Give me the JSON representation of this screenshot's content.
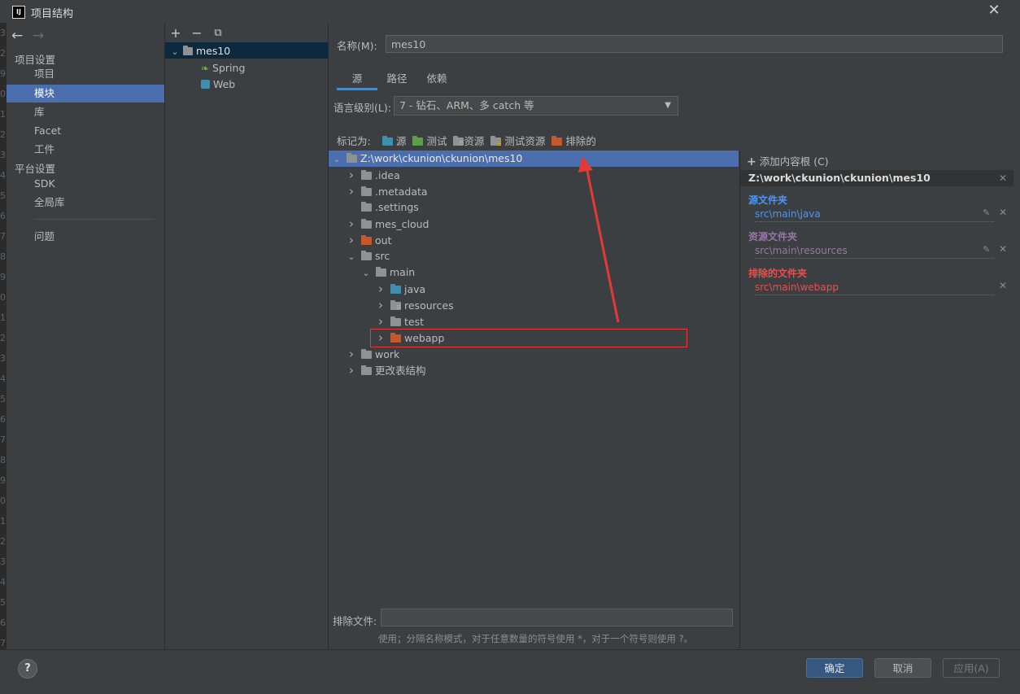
{
  "window": {
    "title": "项目结构",
    "logo": "IJ"
  },
  "gutter": {
    "numbers": [
      "3",
      "2",
      "9",
      "0",
      "1",
      "2",
      "3",
      "4",
      "5",
      "6",
      "7",
      "8",
      "9",
      "0",
      "1",
      "2",
      "3",
      "4",
      "5",
      "6",
      "7",
      "8",
      "9",
      "0",
      "1",
      "2",
      "3",
      "4",
      "5",
      "6",
      "7",
      "8",
      "9"
    ]
  },
  "sidebar": {
    "section1": "项目设置",
    "items1": [
      "项目",
      "模块",
      "库",
      "Facet",
      "工件"
    ],
    "selected": "模块",
    "section2": "平台设置",
    "items2": [
      "SDK",
      "全局库"
    ],
    "problems": "问题"
  },
  "modules": {
    "toolbar": {
      "add": "+",
      "remove": "−",
      "copy": "⧉"
    },
    "root": "mes10",
    "children": [
      "Spring",
      "Web"
    ]
  },
  "content": {
    "name_label": "名称(M):",
    "name_value": "mes10",
    "tabs": [
      "源",
      "路径",
      "依赖"
    ],
    "active_tab": "源",
    "lang_label": "语言级别(L):",
    "lang_value": "7 - 钻石、ARM、多 catch 等",
    "mark_as_label": "标记为:",
    "mark_buttons": [
      "源",
      "测试",
      "资源",
      "测试资源",
      "排除的"
    ],
    "tree": [
      {
        "label": "Z:\\work\\ckunion\\ckunion\\mes10",
        "depth": 0,
        "expanded": true,
        "icon": "gray",
        "selected": true
      },
      {
        "label": ".idea",
        "depth": 1,
        "expandable": true,
        "icon": "gray"
      },
      {
        "label": ".metadata",
        "depth": 1,
        "expandable": true,
        "icon": "gray"
      },
      {
        "label": ".settings",
        "depth": 1,
        "expandable": false,
        "icon": "gray"
      },
      {
        "label": "mes_cloud",
        "depth": 1,
        "expandable": true,
        "icon": "gray"
      },
      {
        "label": "out",
        "depth": 1,
        "expandable": true,
        "icon": "orange"
      },
      {
        "label": "src",
        "depth": 1,
        "expanded": true,
        "icon": "gray"
      },
      {
        "label": "main",
        "depth": 2,
        "expanded": true,
        "icon": "gray"
      },
      {
        "label": "java",
        "depth": 3,
        "expandable": true,
        "icon": "blue"
      },
      {
        "label": "resources",
        "depth": 3,
        "expandable": true,
        "icon": "res"
      },
      {
        "label": "test",
        "depth": 3,
        "expandable": true,
        "icon": "gray"
      },
      {
        "label": "webapp",
        "depth": 3,
        "expandable": true,
        "icon": "orange",
        "highlighted": true
      },
      {
        "label": "work",
        "depth": 1,
        "expandable": true,
        "icon": "gray"
      },
      {
        "label": "更改表结构",
        "depth": 1,
        "expandable": true,
        "icon": "gray"
      }
    ],
    "exclude_label": "排除文件:",
    "exclude_value": "",
    "hint": "使用；分隔名称模式，对于任意数量的符号使用 *，对于一个符号则使用 ?。"
  },
  "roots": {
    "add_root": "添加内容根 (C)",
    "root_path": "Z:\\work\\ckunion\\ckunion\\mes10",
    "source_title": "源文件夹",
    "source_path": "src\\main\\java",
    "resource_title": "资源文件夹",
    "resource_path": "src\\main\\resources",
    "excluded_title": "排除的文件夹",
    "excluded_path": "src\\main\\webapp",
    "colors": {
      "source": "#5394ec",
      "resource": "#9876aa",
      "excluded": "#e65050"
    }
  },
  "buttons": {
    "ok": "确定",
    "cancel": "取消",
    "apply": "应用(A)",
    "help": "?"
  },
  "annotation": {
    "color": "#e53935"
  }
}
